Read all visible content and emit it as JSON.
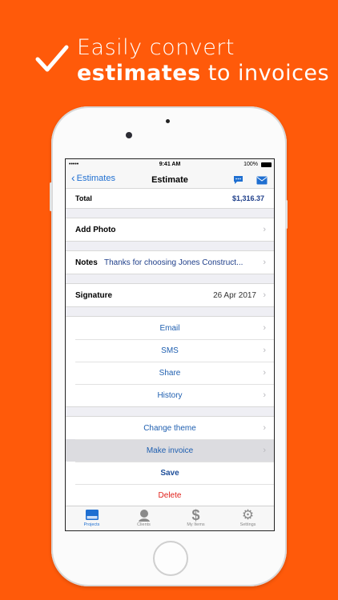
{
  "promo": {
    "line1": "Easily convert",
    "line2_bold": "estimates",
    "line2_rest": " to invoices"
  },
  "status": {
    "signal": "•••••",
    "time": "9:41 AM",
    "battery": "100%"
  },
  "nav": {
    "back_label": "Estimates",
    "title": "Estimate"
  },
  "total": {
    "label": "Total",
    "value": "$1,316.37"
  },
  "add_photo": {
    "label": "Add Photo"
  },
  "notes": {
    "label": "Notes",
    "value": "Thanks for choosing Jones Construct..."
  },
  "signature": {
    "label": "Signature",
    "value": "26 Apr 2017"
  },
  "actions": {
    "email": "Email",
    "sms": "SMS",
    "share": "Share",
    "history": "History"
  },
  "options": {
    "change_theme": "Change theme",
    "make_invoice": "Make invoice",
    "save": "Save",
    "delete": "Delete"
  },
  "tabs": {
    "projects": "Projects",
    "clients": "Clients",
    "my_items": "My Items",
    "settings": "Settings"
  },
  "colors": {
    "background": "#FF5A0A",
    "accent": "#1f6fd1",
    "delete": "#e0201a"
  }
}
